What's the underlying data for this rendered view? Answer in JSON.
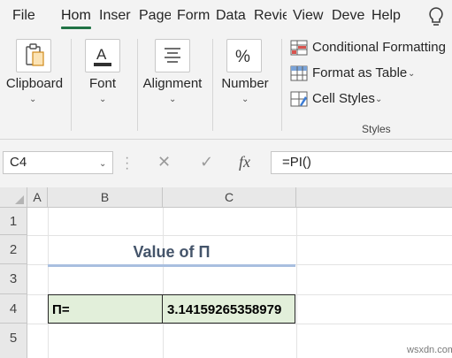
{
  "ribbon_tabs": [
    "File",
    "Hom",
    "Inser",
    "Page",
    "Form",
    "Data",
    "Revie",
    "View",
    "Deve",
    "Help"
  ],
  "active_tab": "Hom",
  "ribbon_groups": {
    "clipboard": "Clipboard",
    "font": "Font",
    "alignment": "Alignment",
    "number": "Number"
  },
  "styles": {
    "conditional_formatting": "Conditional Formatting",
    "format_as_table": "Format as Table",
    "cell_styles": "Cell Styles",
    "group_label": "Styles"
  },
  "formula_bar": {
    "name_box": "C4",
    "formula": "=PI()"
  },
  "grid": {
    "columns": [
      "A",
      "B",
      "C"
    ],
    "rows": [
      "1",
      "2",
      "3",
      "4",
      "5"
    ],
    "title": "Value of Π",
    "label_cell": "Π=",
    "value_cell": "3.14159265358979"
  },
  "watermark": "wsxdn.com",
  "colors": {
    "accent": "#217346",
    "cell_fill": "#e2efda",
    "title_color": "#44546a",
    "title_underline": "#a9bfdf"
  }
}
